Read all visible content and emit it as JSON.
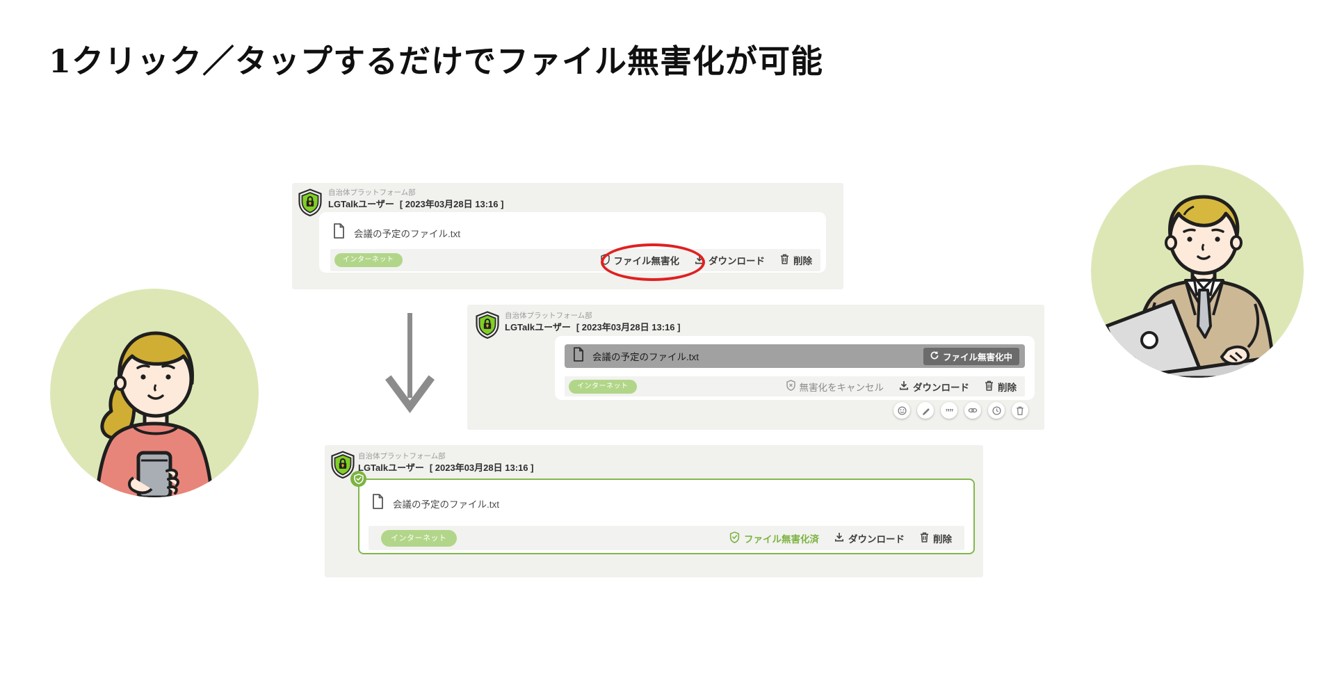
{
  "title": "1クリック／タップするだけでファイル無害化が可能",
  "message": {
    "department": "自治体プラットフォーム部",
    "user": "LGTalkユーザー",
    "timestamp": "[ 2023年03月28日 13:16 ]",
    "filename": "会議の予定のファイル.txt",
    "network_badge": "インターネット"
  },
  "step_initial": {
    "sanitize": "ファイル無害化",
    "download": "ダウンロード",
    "delete": "削除"
  },
  "step_processing": {
    "status": "ファイル無害化中",
    "cancel": "無害化をキャンセル",
    "download": "ダウンロード",
    "delete": "削除"
  },
  "step_done": {
    "status": "ファイル無害化済",
    "download": "ダウンロード",
    "delete": "削除"
  },
  "icons": {
    "quote_glyph": "””"
  },
  "colors": {
    "accent_green": "#7cb342",
    "card_border_green": "#82b84c",
    "badge_green": "#b2d689",
    "annotation_red": "#e02020",
    "processing_bar_gray": "#a1a1a1",
    "processing_button_gray": "#6b6b6b",
    "panel_gray": "#f1f1ee",
    "arrow_gray": "#8c8c8c",
    "illustration_bg_green": "#dde7b6"
  }
}
